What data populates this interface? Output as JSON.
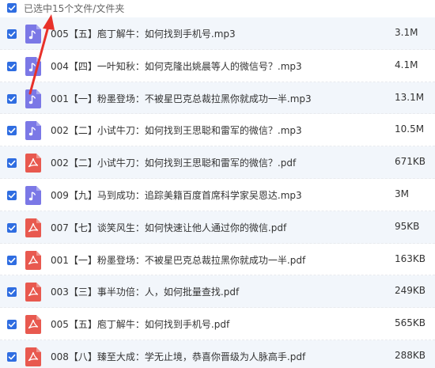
{
  "header": {
    "selection_text": "已选中15个文件/文件夹"
  },
  "colors": {
    "checkbox": "#2f6de1",
    "audio_icon": "#7b78e6",
    "pdf_icon": "#e8594f",
    "annotation_arrow": "#e8312a"
  },
  "icons": {
    "audio": "music-note-icon",
    "pdf": "pdf-icon"
  },
  "files": [
    {
      "name": "005【五】庖丁解牛：如何找到手机号.mp3",
      "size": "3.1M",
      "type": "audio"
    },
    {
      "name": "004【四】一叶知秋：如何克隆出姚晨等人的微信号？.mp3",
      "size": "4.1M",
      "type": "audio"
    },
    {
      "name": "001【一】粉墨登场：不被星巴克总裁拉黑你就成功一半.mp3",
      "size": "13.1M",
      "type": "audio"
    },
    {
      "name": "002【二】小试牛刀：如何找到王思聪和雷军的微信？.mp3",
      "size": "10.5M",
      "type": "audio"
    },
    {
      "name": "002【二】小试牛刀：如何找到王思聪和雷军的微信？.pdf",
      "size": "671KB",
      "type": "pdf"
    },
    {
      "name": "009【九】马到成功：追踪美籍百度首席科学家吴恩达.mp3",
      "size": "3M",
      "type": "audio"
    },
    {
      "name": "007【七】谈笑风生：如何快速让他人通过你的微信.pdf",
      "size": "95KB",
      "type": "pdf"
    },
    {
      "name": "001【一】粉墨登场：不被星巴克总裁拉黑你就成功一半.pdf",
      "size": "163KB",
      "type": "pdf"
    },
    {
      "name": "003【三】事半功倍：人，如何批量查找.pdf",
      "size": "249KB",
      "type": "pdf"
    },
    {
      "name": "005【五】庖丁解牛：如何找到手机号.pdf",
      "size": "565KB",
      "type": "pdf"
    },
    {
      "name": "008【八】臻至大成：学无止境，恭喜你晋级为人脉高手.pdf",
      "size": "288KB",
      "type": "pdf"
    }
  ]
}
